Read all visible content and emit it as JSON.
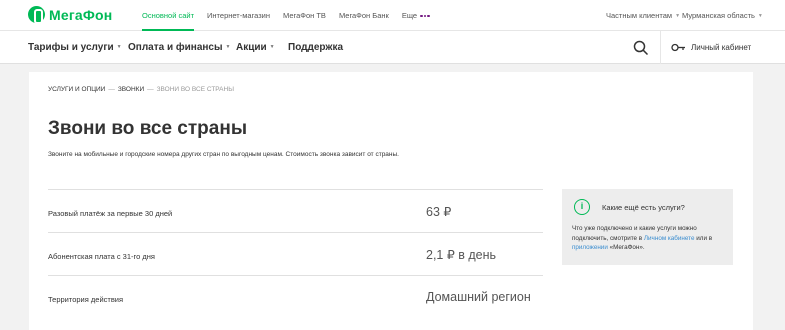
{
  "brand": {
    "name": "МегаФон",
    "color": "#00b956",
    "accent_purple": "#731982"
  },
  "topbar": {
    "links": [
      {
        "label": "Основной сайт",
        "active": true
      },
      {
        "label": "Интернет-магазин"
      },
      {
        "label": "МегаФон ТВ"
      },
      {
        "label": "МегаФон Банк"
      },
      {
        "label": "Еще"
      }
    ],
    "audience": "Частным клиентам",
    "region": "Мурманская область"
  },
  "nav": {
    "items": [
      "Тарифы и услуги",
      "Оплата и финансы",
      "Акции",
      "Поддержка"
    ],
    "search_icon": "search-icon",
    "cabinet_label": "Личный кабинет",
    "cabinet_icon": "key-icon"
  },
  "breadcrumb": {
    "items": [
      "Услуги и опции",
      "Звонки",
      "Звони во все страны"
    ],
    "separator": "—"
  },
  "page": {
    "title": "Звони во все страны",
    "description": "Звоните на мобильные и городские номера других стран по выгодным ценам. Стоимость звонка зависит от страны."
  },
  "table": {
    "rows": [
      {
        "label": "Разовый платёж за первые 30 дней",
        "value": "63 ₽"
      },
      {
        "label": "Абонентская плата с 31-го дня",
        "value": "2,1 ₽ в день"
      },
      {
        "label": "Территория действия",
        "value": "Домашний регион"
      }
    ]
  },
  "infobox": {
    "icon": "info-icon",
    "title": "Какие ещё есть услуги?",
    "text_before": "Что уже подключено и какие услуги можно подключить, смотрите в ",
    "link1": "Личном кабинете",
    "text_middle": " или в ",
    "link2": "приложении",
    "text_after": " «МегаФон»."
  }
}
